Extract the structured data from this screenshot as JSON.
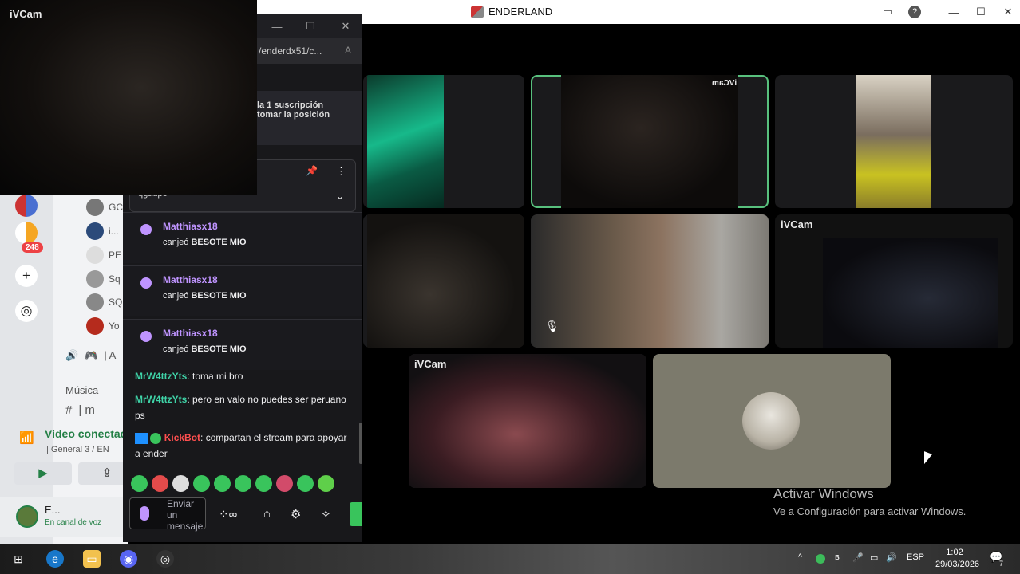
{
  "ivcam_preview": {
    "label": "iVCam"
  },
  "discord_window": {
    "title": "ENDERLAND",
    "controls": {
      "minimize": "—",
      "maximize": "☐",
      "close": "✕"
    }
  },
  "call_tiles": [
    {
      "label": ""
    },
    {
      "label": "",
      "mirror_label": "iVCam"
    },
    {
      "label": ""
    },
    {
      "label": ""
    },
    {
      "label": ""
    },
    {
      "label": "iVCam"
    },
    {
      "label": "iVCam"
    },
    {
      "label": ""
    }
  ],
  "activate_windows": {
    "title": "Activar Windows",
    "subtitle": "Ve a Configuración para activar Windows."
  },
  "sidebar": {
    "unread_badge": "248",
    "members": [
      "GC",
      "i...",
      "PE",
      "Sq",
      "SQ",
      "Yo"
    ],
    "voice_row_text": "| A",
    "music_label": "Música",
    "channel_row_text": "| m",
    "voice_connected": {
      "title": "Video conectado",
      "subtitle": "| General 3 / EN"
    },
    "user": {
      "name": "E...",
      "status": "En canal de voz"
    }
  },
  "chat": {
    "window_controls": {
      "minimize": "—",
      "maximize": "☐",
      "close": "✕"
    },
    "url": "/enderdx51/c...",
    "subscription_line1": "la 1 suscripción",
    "subscription_line2": "tomar la posición",
    "pinned_title": "qgaupo",
    "redemptions": [
      {
        "user": "Matthiasx18",
        "verb": "canjeó",
        "reward": "BESOTE MIO"
      },
      {
        "user": "Matthiasx18",
        "verb": "canjeó",
        "reward": "BESOTE MIO"
      },
      {
        "user": "Matthiasx18",
        "verb": "canjeó",
        "reward": "BESOTE MIO"
      }
    ],
    "messages": [
      {
        "user": "MrW4ttzYts",
        "text": ": toma mi bro"
      },
      {
        "user": "MrW4ttzYts",
        "text": ": pero en valo no puedes ser peruano ps"
      },
      {
        "user": "KickBot",
        "text": ": compartan el stream para apoyar a ender"
      }
    ],
    "input_placeholder": "Enviar un mensaje"
  },
  "taskbar": {
    "language": "ESP",
    "time": "1:02",
    "date": "29/03/2026",
    "notifications": "7"
  }
}
